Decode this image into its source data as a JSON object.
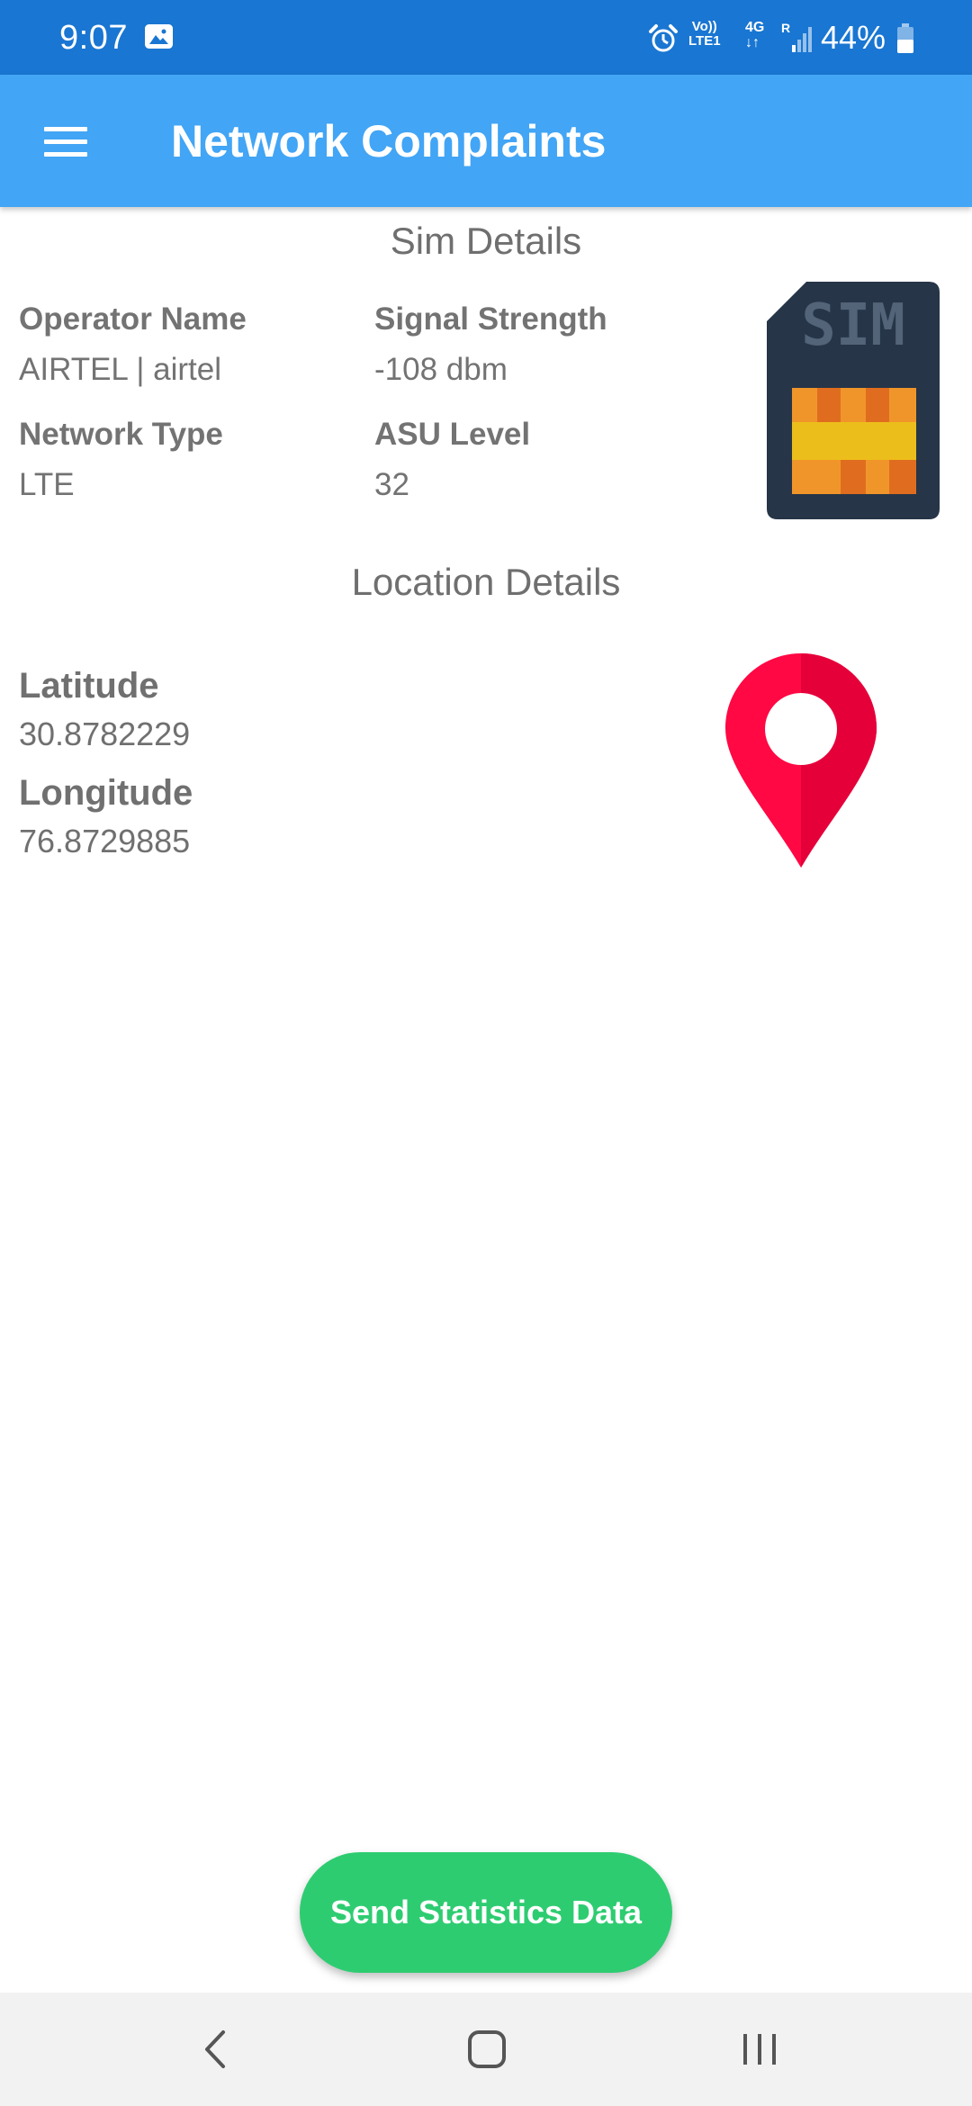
{
  "status_bar": {
    "time": "9:07",
    "volte_top": "Vo))",
    "volte_bottom": "LTE1",
    "network_gen": "4G",
    "roaming": "R",
    "battery": "44%",
    "icons": [
      "gallery-icon",
      "alarm-icon",
      "signal-icon",
      "battery-icon"
    ]
  },
  "app_bar": {
    "title": "Network Complaints",
    "menu_icon": "menu-icon"
  },
  "sim_details": {
    "heading": "Sim Details",
    "operator_label": "Operator Name",
    "operator_value": "AIRTEL | airtel",
    "signal_label": "Signal Strength",
    "signal_value": "-108 dbm",
    "network_type_label": "Network Type",
    "network_type_value": "LTE",
    "asu_label": "ASU Level",
    "asu_value": "32",
    "sim_image_text": "SIM"
  },
  "location_details": {
    "heading": "Location Details",
    "latitude_label": "Latitude",
    "latitude_value": "30.8782229",
    "longitude_label": "Longitude",
    "longitude_value": "76.8729885"
  },
  "actions": {
    "send_label": "Send Statistics Data"
  },
  "nav": {
    "icons": [
      "back-icon",
      "home-icon",
      "recent-apps-icon"
    ]
  },
  "colors": {
    "status_bar": "#1976d2",
    "app_bar": "#42a5f5",
    "send_button": "#2ecc71",
    "pin": "#ff0844",
    "sim_body": "#263548"
  }
}
